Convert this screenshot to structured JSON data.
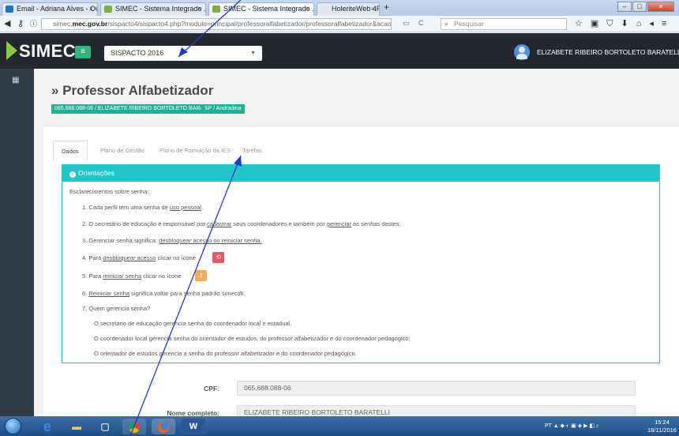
{
  "browser": {
    "tabs": [
      {
        "title": "Email - Adriana Alves - Out...",
        "fav_color": "#1e73be"
      },
      {
        "title": "SIMEC - Sistema Integrado ...",
        "fav_color": "#7fb03d"
      },
      {
        "title": "SIMEC - Sistema Integrado ...",
        "fav_color": "#7fb03d"
      },
      {
        "title": "HoleriteWeb 4R",
        "fav_color": "#dfe8f3"
      }
    ],
    "url_prefix": "simec.",
    "url_domain": "mec.gov.br",
    "url_rest": "/sispacto4/sispacto4.php?modulo=principal/professoralfabetizador/professoralfabetizador&acao=A",
    "search_placeholder": "Pesquisar"
  },
  "app": {
    "logo": "SIMEC",
    "program": "SISPACTO 2016",
    "user": "ELIZABETE RIBEIRO BORTOLETO BARATELLI"
  },
  "page": {
    "title": "» Professor Alfabetizador",
    "badges": [
      "065.688.088-06 / ELIZABETE RIBEIRO BORTOLETO BARATELLI",
      "SP / Andradina"
    ],
    "tabs": [
      "Dados",
      "Plano de Gestão",
      "Plano de Formação da IES",
      "Tarefas"
    ]
  },
  "orientacoes": {
    "header": "Orientações",
    "intro": "Esclarecimentos sobre senha:",
    "items": {
      "i1": {
        "num": "1.",
        "a": "Cada perfil tem uma senha de ",
        "u": "uso pessoal",
        "b": "."
      },
      "i2": {
        "num": "2.",
        "a": "O secretário de educação é responsável por ",
        "u": "cadastrar",
        "b": " seus coordenadores e também por ",
        "u2": "gerenciar",
        "c": " as senhas destes."
      },
      "i3": {
        "num": "3.",
        "a": "Gerenciar senha significa: ",
        "u": "desbloquear acesso ou reiniciar senha."
      },
      "i4": {
        "num": "4.",
        "a": "Para ",
        "u": "desbloquear acesso",
        "b": " clicar no ícone"
      },
      "i5": {
        "num": "5.",
        "a": "Para ",
        "u": "reiniciar senha",
        "b": " clicar no ícone"
      },
      "i6": {
        "num": "6.",
        "u": "Reiniciar senha",
        "a": " significa voltar para senha padrão ",
        "em": "simecdti."
      },
      "i7": {
        "num": "7.",
        "a": "Quem gerencia senha?"
      }
    },
    "sub": [
      "O secretario de educação gerencia senha do coordenador local e estadual.",
      "O coordenador local gerencia senha do orientador de estudos, do professor alfabetizador e do coordenador pedagógico;",
      "O orientador de estudos gerencia a senha do professor alfabetizador e do coordenador pedagógico."
    ]
  },
  "form": {
    "cpf_label": "CPF:",
    "cpf_value": "065.688.088-06",
    "nome_label": "Nome completo:",
    "nome_value": "ELIZABETE RIBEIRO BORTOLETO BARATELLI"
  },
  "taskbar": {
    "lang": "PT",
    "time": "15:24",
    "date": "18/11/2016"
  },
  "colors": {
    "accent": "#1ab394",
    "panel": "#23c6c8",
    "header": "#22282d",
    "sidebar": "#2f3a45"
  }
}
